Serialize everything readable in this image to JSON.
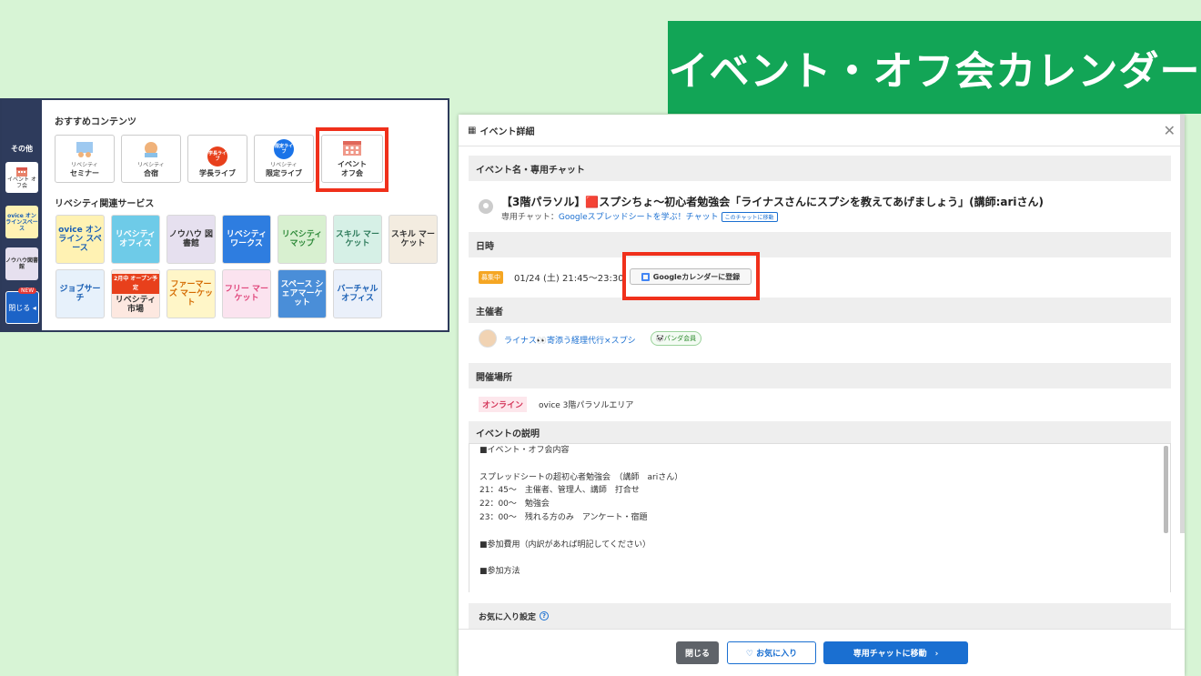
{
  "banner": {
    "title": "イベント・オフ会カレンダー"
  },
  "left_panel": {
    "sidebar": {
      "section_label": "その他",
      "items": [
        {
          "label": "イベント オフ会"
        },
        {
          "label": "ovice オンラインスペース"
        },
        {
          "label": "ノウハウ図書館"
        }
      ],
      "new_badge": "NEW",
      "close_label": "閉じる ◂"
    },
    "recommended_title": "おすすめコンテンツ",
    "recommended": [
      {
        "top": "リベシティ",
        "bottom": "セミナー"
      },
      {
        "top": "リベシティ",
        "bottom": "合宿"
      },
      {
        "top": "",
        "bottom": "学長ライブ",
        "icon_text": "学長ライブ"
      },
      {
        "top": "リベシティ",
        "bottom": "限定ライブ",
        "icon_text": "限定ライブ"
      },
      {
        "top": "イベント",
        "bottom": "オフ会"
      }
    ],
    "services_title": "リベシティ関連サービス",
    "services": [
      {
        "label": "ovice オンライン スペース",
        "bg": "#fff2b3",
        "fg": "#1a5fb4"
      },
      {
        "label": "リベシティ オフィス",
        "bg": "#6ecbe8",
        "fg": "#ffffff"
      },
      {
        "label": "ノウハウ 図書館",
        "bg": "#e6e0ef",
        "fg": "#333333"
      },
      {
        "label": "リベシティ ワークス",
        "bg": "#2e7de0",
        "fg": "#ffffff"
      },
      {
        "label": "リベシティ マップ",
        "bg": "#d8f0d0",
        "fg": "#2f8a3a"
      },
      {
        "label": "スキル マーケット",
        "bg": "#d6f0e6",
        "fg": "#2d7a5a"
      },
      {
        "label": "スキル マーケット",
        "bg": "#f3ece0",
        "fg": "#333333"
      },
      {
        "label": "ジョブサーチ",
        "bg": "#e7f1fb",
        "fg": "#1a5fb4"
      },
      {
        "label": "リベシティ 市場",
        "bg": "#fde8e0",
        "fg": "#333333"
      },
      {
        "label": "ファーマーズ マーケット",
        "bg": "#fff6c8",
        "fg": "#d46a00"
      },
      {
        "label": "フリー マーケット",
        "bg": "#fbe3ef",
        "fg": "#e0457b"
      },
      {
        "label": "スペース シェアマーケット",
        "bg": "#4a8ed8",
        "fg": "#ffffff"
      },
      {
        "label": "バーチャル オフィス",
        "bg": "#eaf0fa",
        "fg": "#1a5fb4"
      }
    ],
    "service_badge": "2月中 オープン予定"
  },
  "modal": {
    "title": "イベント詳細",
    "sections": {
      "name_header": "イベント名・専用チャット",
      "event_name": "【3階パラソル】🟥スプシちょ〜初心者勉強会「ライナスさんにスプシを教えてあげましょう」(講師:ariさん)",
      "chat_prefix": "専用チャット：",
      "chat_link": "Googleスプレッドシートを学ぶ！チャット",
      "chat_move": "このチャットに移動",
      "date_header": "日時",
      "status_badge": "募集中",
      "datetime": "01/24 (土) 21:45〜23:30",
      "gcal_button": "Googleカレンダーに登録",
      "organizer_header": "主催者",
      "organizer_name": "ライナス👀寄添う経理代行×スプシ",
      "organizer_badge": "🐼パンダ会員",
      "place_header": "開催場所",
      "place_type": "オンライン",
      "place_name": "ovice 3階パラソルエリア",
      "desc_header": "イベントの説明",
      "desc_lines": [
        "■イベント・オフ会内容",
        "",
        "スプレッドシートの超初心者勉強会　（講師　ariさん）",
        "21：45〜　主催者、管理人、講師　打合せ",
        "22：00〜　勉強会",
        "23：00〜　残れる方のみ　アンケート・宿題",
        "",
        "■参加費用（内訳があれば明記してください）",
        "",
        "■参加方法",
        ""
      ],
      "fav_settings": "お気に入り設定"
    },
    "footer": {
      "close": "閉じる",
      "favorite": "♡ お気に入り",
      "chat": "専用チャットに移動　›"
    }
  }
}
